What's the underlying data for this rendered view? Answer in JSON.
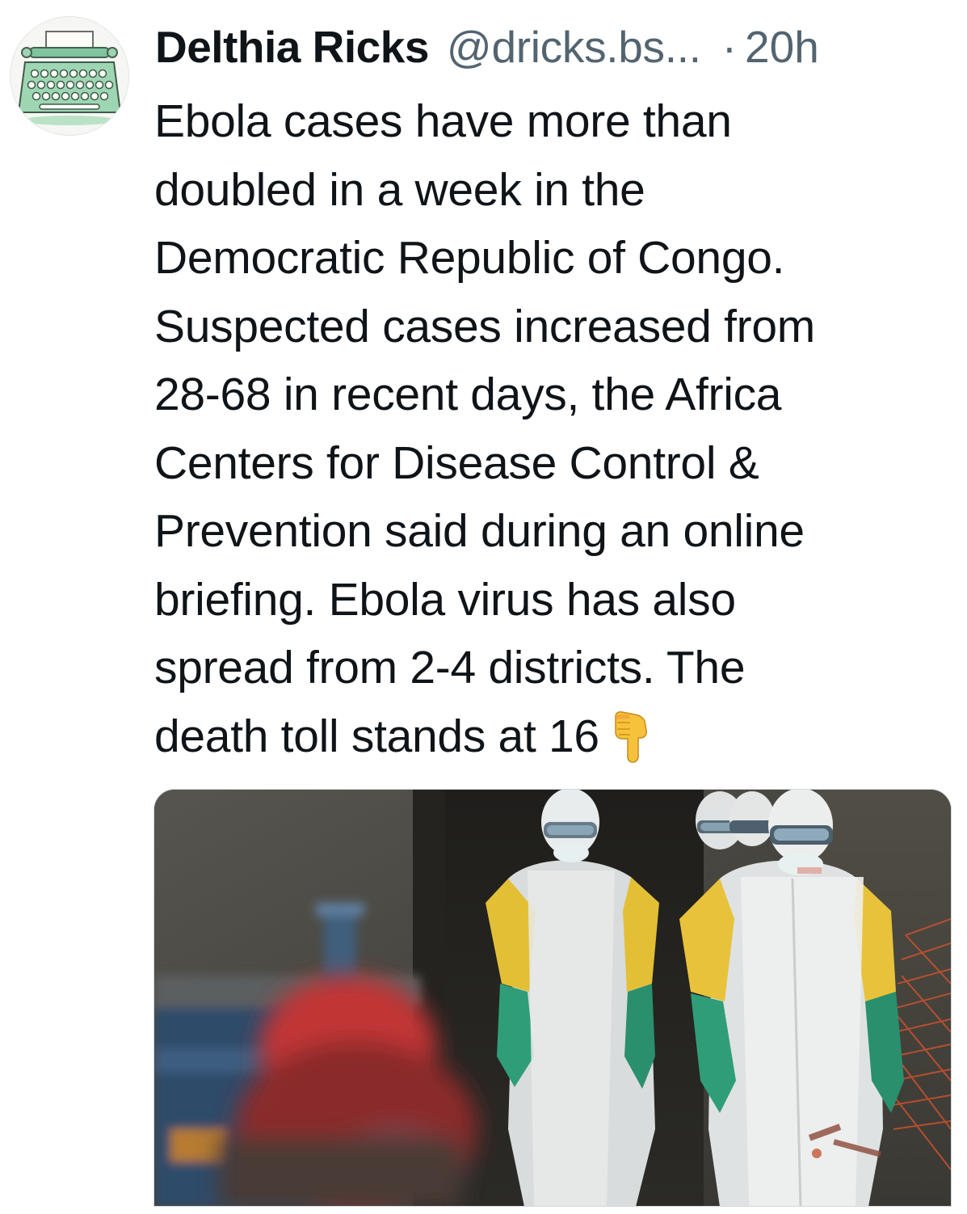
{
  "post": {
    "author": {
      "display_name": "Delthia Ricks",
      "handle": "@dricks.bs...",
      "avatar_icon": "typewriter-icon"
    },
    "separator": "·",
    "timestamp": "20h",
    "text_lines": [
      "Ebola cases have more than",
      "doubled in a week in the",
      "Democratic Republic of Congo.",
      "Suspected cases increased from",
      "28-68 in recent days, the Africa",
      "Centers for Disease Control &",
      "Prevention said during an online",
      "briefing. Ebola virus has also",
      "spread from 2-4 districts. The",
      "death toll stands at 16"
    ],
    "trailing_emoji": "pointing-down-hand-icon",
    "media": {
      "icon": "photo-health-workers-protective-suits"
    }
  },
  "colors": {
    "text_primary": "#0f1419",
    "text_secondary": "#536471",
    "suit_yellow": "#e8c23a",
    "glove_green": "#2f9e78"
  }
}
